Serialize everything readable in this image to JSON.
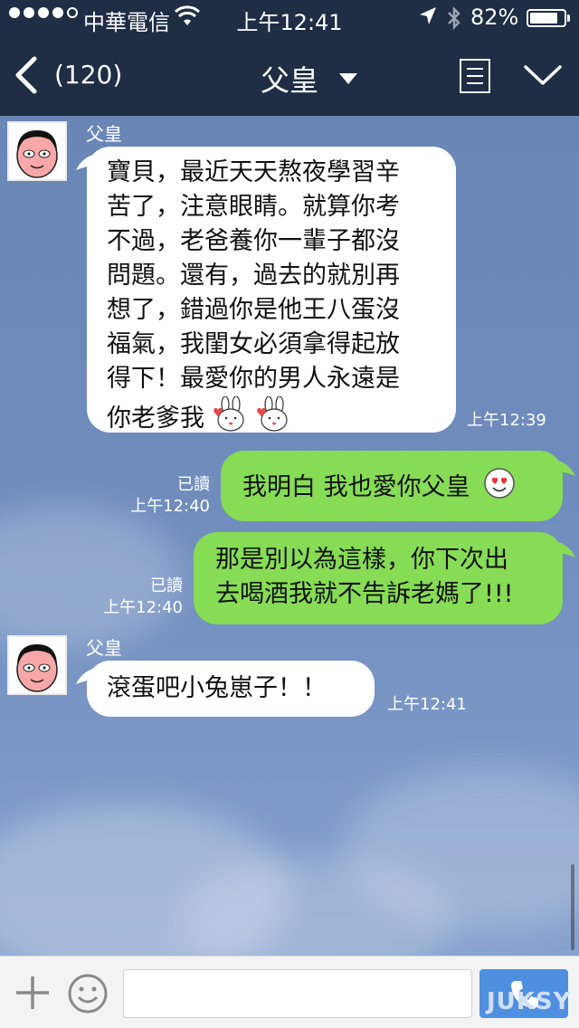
{
  "status_bar": {
    "carrier": "中華電信",
    "time": "上午12:41",
    "battery_percent_text": "82%",
    "battery_level": 0.82
  },
  "nav": {
    "back_count": "(120)",
    "title": "父皇"
  },
  "messages": [
    {
      "sender": "父皇",
      "text": "寶貝，最近天天熬夜學習辛苦了，注意眼睛。就算你考不過，老爸養你一輩子都沒問題。還有，過去的就別再想了，錯過你是他王八蛋沒福氣，我閨女必須拿得起放得下！最愛你的男人永遠是你老爹我",
      "time": "上午12:39",
      "lines": [
        "寶貝，最近天天熬夜學習辛",
        "苦了，注意眼睛。就算你考",
        "不過，老爸養你一輩子都沒",
        "問題。還有，過去的就別再",
        "想了，錯過你是他王八蛋沒",
        "福氣，我閨女必須拿得起放",
        "得下！最愛你的男人永遠是",
        "你老爹我"
      ]
    },
    {
      "text": "我明白 我也愛你父皇",
      "read": "已讀",
      "time": "上午12:40"
    },
    {
      "lines": [
        "那是別以為這樣，你下次出",
        "去喝酒我就不告訴老媽了!!!"
      ],
      "read": "已讀",
      "time": "上午12:40"
    },
    {
      "sender": "父皇",
      "text": "滾蛋吧小兔崽子！！",
      "time": "上午12:41"
    }
  ],
  "input_bar": {
    "placeholder": ""
  },
  "watermark": "JUKSY",
  "colors": {
    "header": "#1f2d45",
    "bubble_out": "#86dc54",
    "bubble_in": "#ffffff",
    "send_button": "#4f8fe0"
  }
}
